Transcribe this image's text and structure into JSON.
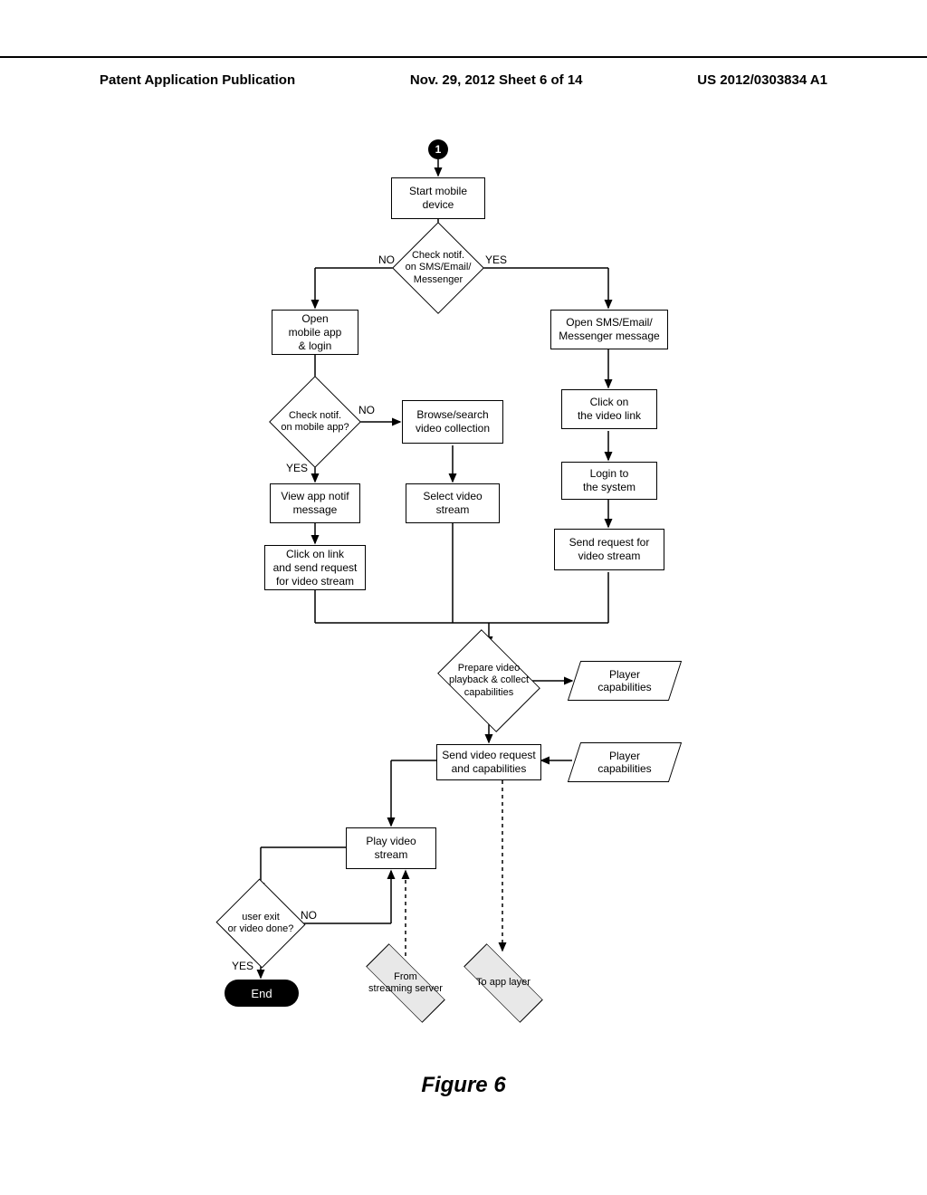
{
  "header": {
    "left": "Patent Application Publication",
    "mid": "Nov. 29, 2012   Sheet 6 of 14",
    "right": "US 2012/0303834 A1"
  },
  "connector": {
    "label": "1"
  },
  "boxes": {
    "start_mobile": "Start mobile\ndevice",
    "open_app": "Open\nmobile app\n& login",
    "browse": "Browse/search\nvideo collection",
    "view_notif": "View app notif\nmessage",
    "select_video": "Select video\nstream",
    "click_link_left": "Click on link\nand send request\nfor video stream",
    "open_sms": "Open SMS/Email/\nMessenger message",
    "click_video_link": "Click on\nthe video link",
    "login_system": "Login to\nthe system",
    "send_request_right": "Send request for\nvideo stream",
    "send_video_req": "Send video request\nand capabilities",
    "play_video": "Play video\nstream"
  },
  "diamonds": {
    "check_notif_top": "Check notif.\non SMS/Email/\nMessenger",
    "check_notif_app": "Check notif.\non mobile app?",
    "prepare_video": "Prepare video\nplayback & collect\ncapabilities",
    "user_exit": "user exit\nor video done?",
    "from_server": "From\nstreaming server",
    "to_app_layer": "To app layer"
  },
  "parals": {
    "player_caps_1": "Player\ncapabilities",
    "player_caps_2": "Player\ncapabilities"
  },
  "branch_labels": {
    "no": "NO",
    "yes": "YES"
  },
  "end_label": "End",
  "figure_title": "Figure 6",
  "chart_data": {
    "type": "flowchart",
    "title": "Figure 6",
    "nodes": [
      {
        "id": "conn1",
        "shape": "offpage-connector",
        "label": "1"
      },
      {
        "id": "start",
        "shape": "process",
        "label": "Start mobile device"
      },
      {
        "id": "d_check_sms",
        "shape": "decision",
        "label": "Check notif. on SMS/Email/Messenger"
      },
      {
        "id": "open_app",
        "shape": "process",
        "label": "Open mobile app & login"
      },
      {
        "id": "d_check_app",
        "shape": "decision",
        "label": "Check notif. on mobile app?"
      },
      {
        "id": "browse",
        "shape": "process",
        "label": "Browse/search video collection"
      },
      {
        "id": "view_notif",
        "shape": "process",
        "label": "View app notif message"
      },
      {
        "id": "select_video",
        "shape": "process",
        "label": "Select video stream"
      },
      {
        "id": "click_link_left",
        "shape": "process",
        "label": "Click on link and send request for video stream"
      },
      {
        "id": "open_sms_msg",
        "shape": "process",
        "label": "Open SMS/Email/Messenger message"
      },
      {
        "id": "click_video_link",
        "shape": "process",
        "label": "Click on the video link"
      },
      {
        "id": "login_system",
        "shape": "process",
        "label": "Login to the system"
      },
      {
        "id": "send_req_right",
        "shape": "process",
        "label": "Send request for video stream"
      },
      {
        "id": "d_prepare",
        "shape": "decision",
        "label": "Prepare video playback & collect capabilities"
      },
      {
        "id": "caps1",
        "shape": "data",
        "label": "Player capabilities"
      },
      {
        "id": "send_video_req",
        "shape": "process",
        "label": "Send video request and capabilities"
      },
      {
        "id": "caps2",
        "shape": "data",
        "label": "Player capabilities"
      },
      {
        "id": "play",
        "shape": "process",
        "label": "Play video stream"
      },
      {
        "id": "d_exit",
        "shape": "decision",
        "label": "user exit or video done?"
      },
      {
        "id": "d_from_server",
        "shape": "decision-shaded",
        "label": "From streaming server"
      },
      {
        "id": "d_to_app",
        "shape": "decision-shaded",
        "label": "To app layer"
      },
      {
        "id": "end",
        "shape": "terminator",
        "label": "End"
      }
    ],
    "edges": [
      {
        "from": "conn1",
        "to": "start"
      },
      {
        "from": "start",
        "to": "d_check_sms"
      },
      {
        "from": "d_check_sms",
        "to": "open_app",
        "label": "NO"
      },
      {
        "from": "d_check_sms",
        "to": "open_sms_msg",
        "label": "YES"
      },
      {
        "from": "open_app",
        "to": "d_check_app"
      },
      {
        "from": "d_check_app",
        "to": "browse",
        "label": "NO"
      },
      {
        "from": "d_check_app",
        "to": "view_notif",
        "label": "YES"
      },
      {
        "from": "browse",
        "to": "select_video"
      },
      {
        "from": "view_notif",
        "to": "click_link_left"
      },
      {
        "from": "select_video",
        "to": "d_prepare"
      },
      {
        "from": "click_link_left",
        "to": "d_prepare"
      },
      {
        "from": "open_sms_msg",
        "to": "click_video_link"
      },
      {
        "from": "click_video_link",
        "to": "login_system"
      },
      {
        "from": "login_system",
        "to": "send_req_right"
      },
      {
        "from": "send_req_right",
        "to": "d_prepare"
      },
      {
        "from": "d_prepare",
        "to": "caps1"
      },
      {
        "from": "d_prepare",
        "to": "send_video_req"
      },
      {
        "from": "caps2",
        "to": "send_video_req"
      },
      {
        "from": "send_video_req",
        "to": "d_to_app",
        "style": "dashed"
      },
      {
        "from": "send_video_req",
        "to": "play"
      },
      {
        "from": "d_from_server",
        "to": "play",
        "style": "dashed"
      },
      {
        "from": "play",
        "to": "d_exit"
      },
      {
        "from": "d_exit",
        "to": "play",
        "label": "NO"
      },
      {
        "from": "d_exit",
        "to": "end",
        "label": "YES"
      }
    ]
  }
}
